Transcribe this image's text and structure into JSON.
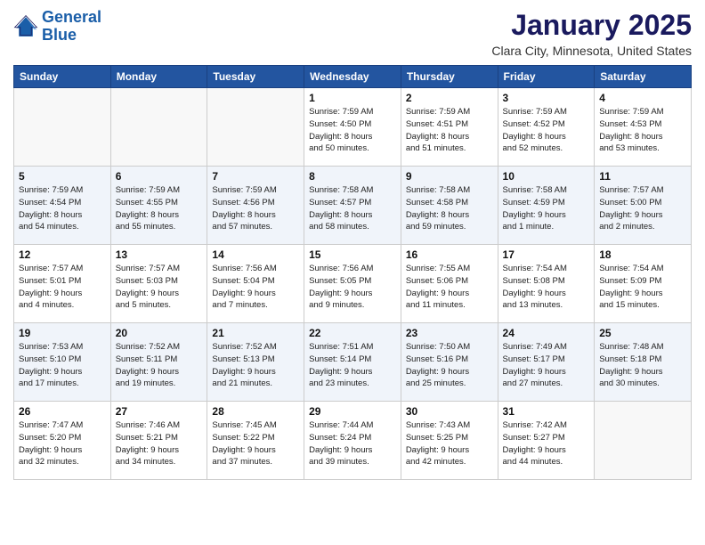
{
  "header": {
    "logo_line1": "General",
    "logo_line2": "Blue",
    "month": "January 2025",
    "location": "Clara City, Minnesota, United States"
  },
  "weekdays": [
    "Sunday",
    "Monday",
    "Tuesday",
    "Wednesday",
    "Thursday",
    "Friday",
    "Saturday"
  ],
  "weeks": [
    [
      {
        "day": "",
        "info": ""
      },
      {
        "day": "",
        "info": ""
      },
      {
        "day": "",
        "info": ""
      },
      {
        "day": "1",
        "info": "Sunrise: 7:59 AM\nSunset: 4:50 PM\nDaylight: 8 hours\nand 50 minutes."
      },
      {
        "day": "2",
        "info": "Sunrise: 7:59 AM\nSunset: 4:51 PM\nDaylight: 8 hours\nand 51 minutes."
      },
      {
        "day": "3",
        "info": "Sunrise: 7:59 AM\nSunset: 4:52 PM\nDaylight: 8 hours\nand 52 minutes."
      },
      {
        "day": "4",
        "info": "Sunrise: 7:59 AM\nSunset: 4:53 PM\nDaylight: 8 hours\nand 53 minutes."
      }
    ],
    [
      {
        "day": "5",
        "info": "Sunrise: 7:59 AM\nSunset: 4:54 PM\nDaylight: 8 hours\nand 54 minutes."
      },
      {
        "day": "6",
        "info": "Sunrise: 7:59 AM\nSunset: 4:55 PM\nDaylight: 8 hours\nand 55 minutes."
      },
      {
        "day": "7",
        "info": "Sunrise: 7:59 AM\nSunset: 4:56 PM\nDaylight: 8 hours\nand 57 minutes."
      },
      {
        "day": "8",
        "info": "Sunrise: 7:58 AM\nSunset: 4:57 PM\nDaylight: 8 hours\nand 58 minutes."
      },
      {
        "day": "9",
        "info": "Sunrise: 7:58 AM\nSunset: 4:58 PM\nDaylight: 8 hours\nand 59 minutes."
      },
      {
        "day": "10",
        "info": "Sunrise: 7:58 AM\nSunset: 4:59 PM\nDaylight: 9 hours\nand 1 minute."
      },
      {
        "day": "11",
        "info": "Sunrise: 7:57 AM\nSunset: 5:00 PM\nDaylight: 9 hours\nand 2 minutes."
      }
    ],
    [
      {
        "day": "12",
        "info": "Sunrise: 7:57 AM\nSunset: 5:01 PM\nDaylight: 9 hours\nand 4 minutes."
      },
      {
        "day": "13",
        "info": "Sunrise: 7:57 AM\nSunset: 5:03 PM\nDaylight: 9 hours\nand 5 minutes."
      },
      {
        "day": "14",
        "info": "Sunrise: 7:56 AM\nSunset: 5:04 PM\nDaylight: 9 hours\nand 7 minutes."
      },
      {
        "day": "15",
        "info": "Sunrise: 7:56 AM\nSunset: 5:05 PM\nDaylight: 9 hours\nand 9 minutes."
      },
      {
        "day": "16",
        "info": "Sunrise: 7:55 AM\nSunset: 5:06 PM\nDaylight: 9 hours\nand 11 minutes."
      },
      {
        "day": "17",
        "info": "Sunrise: 7:54 AM\nSunset: 5:08 PM\nDaylight: 9 hours\nand 13 minutes."
      },
      {
        "day": "18",
        "info": "Sunrise: 7:54 AM\nSunset: 5:09 PM\nDaylight: 9 hours\nand 15 minutes."
      }
    ],
    [
      {
        "day": "19",
        "info": "Sunrise: 7:53 AM\nSunset: 5:10 PM\nDaylight: 9 hours\nand 17 minutes."
      },
      {
        "day": "20",
        "info": "Sunrise: 7:52 AM\nSunset: 5:11 PM\nDaylight: 9 hours\nand 19 minutes."
      },
      {
        "day": "21",
        "info": "Sunrise: 7:52 AM\nSunset: 5:13 PM\nDaylight: 9 hours\nand 21 minutes."
      },
      {
        "day": "22",
        "info": "Sunrise: 7:51 AM\nSunset: 5:14 PM\nDaylight: 9 hours\nand 23 minutes."
      },
      {
        "day": "23",
        "info": "Sunrise: 7:50 AM\nSunset: 5:16 PM\nDaylight: 9 hours\nand 25 minutes."
      },
      {
        "day": "24",
        "info": "Sunrise: 7:49 AM\nSunset: 5:17 PM\nDaylight: 9 hours\nand 27 minutes."
      },
      {
        "day": "25",
        "info": "Sunrise: 7:48 AM\nSunset: 5:18 PM\nDaylight: 9 hours\nand 30 minutes."
      }
    ],
    [
      {
        "day": "26",
        "info": "Sunrise: 7:47 AM\nSunset: 5:20 PM\nDaylight: 9 hours\nand 32 minutes."
      },
      {
        "day": "27",
        "info": "Sunrise: 7:46 AM\nSunset: 5:21 PM\nDaylight: 9 hours\nand 34 minutes."
      },
      {
        "day": "28",
        "info": "Sunrise: 7:45 AM\nSunset: 5:22 PM\nDaylight: 9 hours\nand 37 minutes."
      },
      {
        "day": "29",
        "info": "Sunrise: 7:44 AM\nSunset: 5:24 PM\nDaylight: 9 hours\nand 39 minutes."
      },
      {
        "day": "30",
        "info": "Sunrise: 7:43 AM\nSunset: 5:25 PM\nDaylight: 9 hours\nand 42 minutes."
      },
      {
        "day": "31",
        "info": "Sunrise: 7:42 AM\nSunset: 5:27 PM\nDaylight: 9 hours\nand 44 minutes."
      },
      {
        "day": "",
        "info": ""
      }
    ]
  ]
}
